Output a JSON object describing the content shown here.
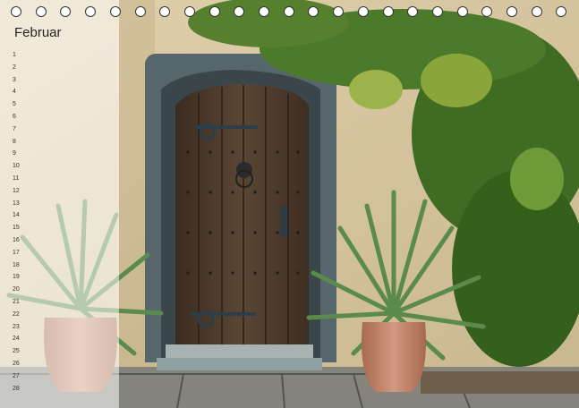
{
  "calendar": {
    "month": "Februar",
    "days": [
      "1",
      "2",
      "3",
      "4",
      "5",
      "6",
      "7",
      "8",
      "9",
      "10",
      "11",
      "12",
      "13",
      "14",
      "15",
      "16",
      "17",
      "18",
      "19",
      "20",
      "21",
      "22",
      "23",
      "24",
      "25",
      "26",
      "27",
      "28"
    ]
  },
  "colors": {
    "stone_wall": "#d8c8a2",
    "door_wood": "#4a3a2c",
    "door_frame": "#4c5c64",
    "ivy": "#3f6b22",
    "agave": "#5b8a4e",
    "terracotta": "#c8876b",
    "paving": "#7c7c74"
  },
  "image_description_icons": [
    "wooden-door",
    "ivy",
    "agave-plant",
    "terracotta-pot",
    "binding-ring"
  ]
}
